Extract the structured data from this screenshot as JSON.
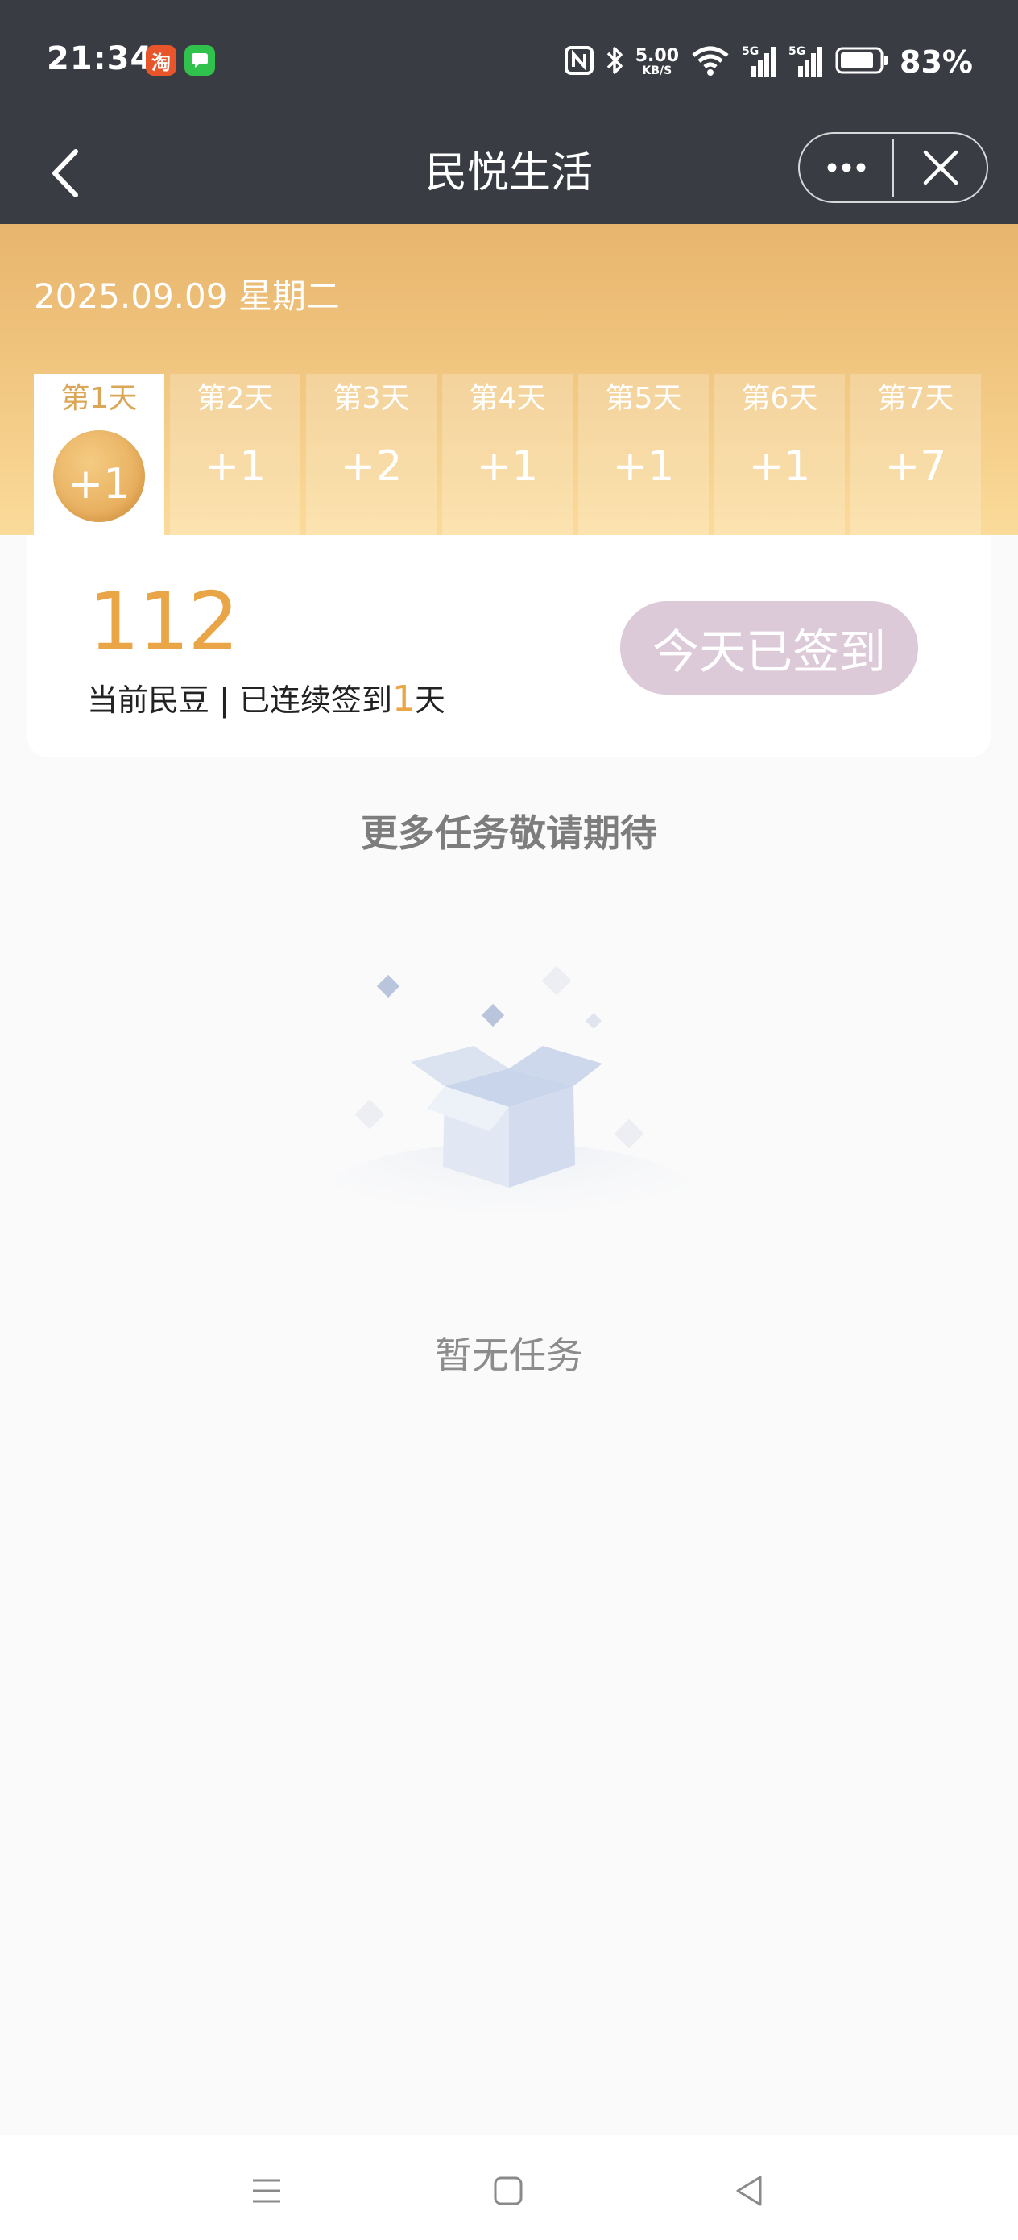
{
  "status_bar": {
    "time": "21:34",
    "apps": [
      "淘",
      ""
    ],
    "net_speed": "5.00",
    "net_unit": "KB/S",
    "sig1": "5G",
    "sig2": "5G",
    "battery": "83%"
  },
  "nav": {
    "title": "民悦生活"
  },
  "checkin": {
    "date": "2025.09.09 星期二",
    "days": [
      {
        "label": "第1天",
        "value": "+1"
      },
      {
        "label": "第2天",
        "value": "+1"
      },
      {
        "label": "第3天",
        "value": "+2"
      },
      {
        "label": "第4天",
        "value": "+1"
      },
      {
        "label": "第5天",
        "value": "+1"
      },
      {
        "label": "第6天",
        "value": "+1"
      },
      {
        "label": "第7天",
        "value": "+7"
      }
    ],
    "points": "112",
    "points_label": "当前民豆 | 已连续签到",
    "streak": "1",
    "streak_unit": "天",
    "button_label": "今天已签到"
  },
  "tasks": {
    "heading": "更多任务敬请期待",
    "empty_text": "暂无任务"
  }
}
